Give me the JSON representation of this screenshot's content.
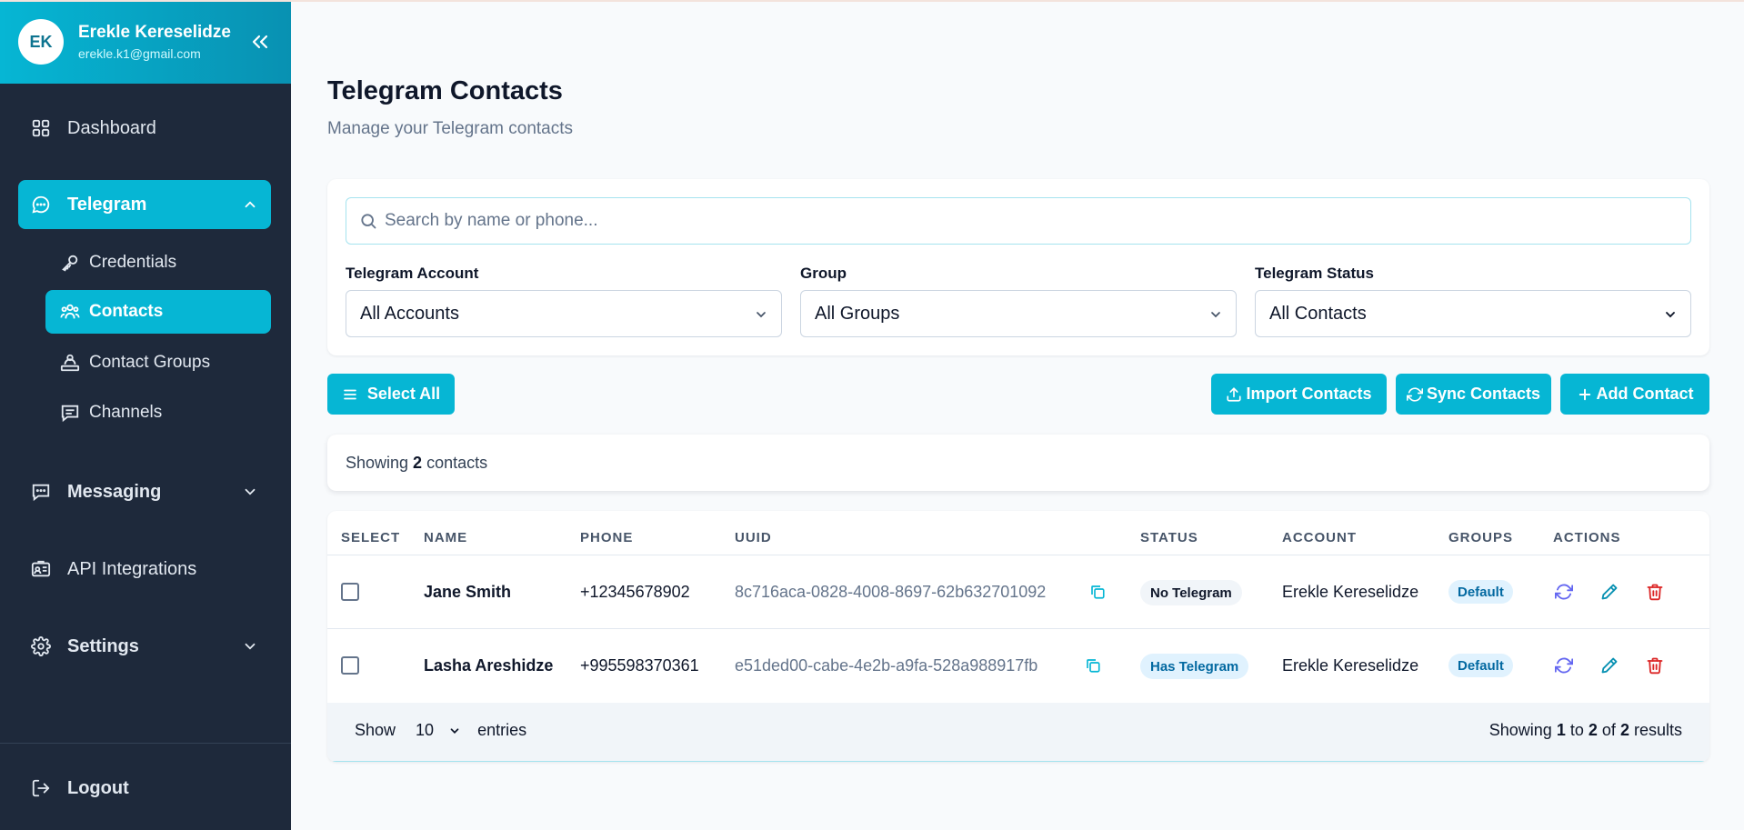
{
  "user": {
    "initials": "EK",
    "name": "Erekle Kereselidze",
    "email": "erekle.k1@gmail.com"
  },
  "sidebar": {
    "dashboard": "Dashboard",
    "telegram": "Telegram",
    "telegram_sub": [
      "Credentials",
      "Contacts",
      "Contact Groups",
      "Channels"
    ],
    "messaging": "Messaging",
    "api": "API Integrations",
    "settings": "Settings",
    "logout": "Logout"
  },
  "page": {
    "title": "Telegram Contacts",
    "subtitle": "Manage your Telegram contacts"
  },
  "filters": {
    "search_placeholder": "Search by name or phone...",
    "account_label": "Telegram Account",
    "account_value": "All Accounts",
    "group_label": "Group",
    "group_value": "All Groups",
    "status_label": "Telegram Status",
    "status_value": "All Contacts"
  },
  "actions": {
    "select_all": "Select All",
    "import": "Import Contacts",
    "sync": "Sync Contacts",
    "add": "Add Contact"
  },
  "summary": {
    "prefix": "Showing",
    "count": "2",
    "suffix": "contacts"
  },
  "table": {
    "headers": [
      "SELECT",
      "NAME",
      "PHONE",
      "UUID",
      "STATUS",
      "ACCOUNT",
      "GROUPS",
      "ACTIONS"
    ],
    "rows": [
      {
        "name": "Jane Smith",
        "phone": "+12345678902",
        "uuid": "8c716aca-0828-4008-8697-62b632701092",
        "status": "No Telegram",
        "account": "Erekle Kereselidze",
        "group": "Default"
      },
      {
        "name": "Lasha Areshidze",
        "phone": "+995598370361",
        "uuid": "e51ded00-cabe-4e2b-a9fa-528a988917fb",
        "status": "Has Telegram",
        "account": "Erekle Kereselidze",
        "group": "Default"
      }
    ]
  },
  "footer": {
    "show": "Show",
    "entries_value": "10",
    "entries": "entries",
    "results_prefix": "Showing",
    "from": "1",
    "to_word": "to",
    "to": "2",
    "of_word": "of",
    "total": "2",
    "results_word": "results"
  },
  "colors": {
    "accent": "#06b6d4",
    "sidebar": "#1e293b",
    "danger": "#dc2626",
    "sync_icon": "#6366f1",
    "edit_icon": "#0891b2"
  }
}
